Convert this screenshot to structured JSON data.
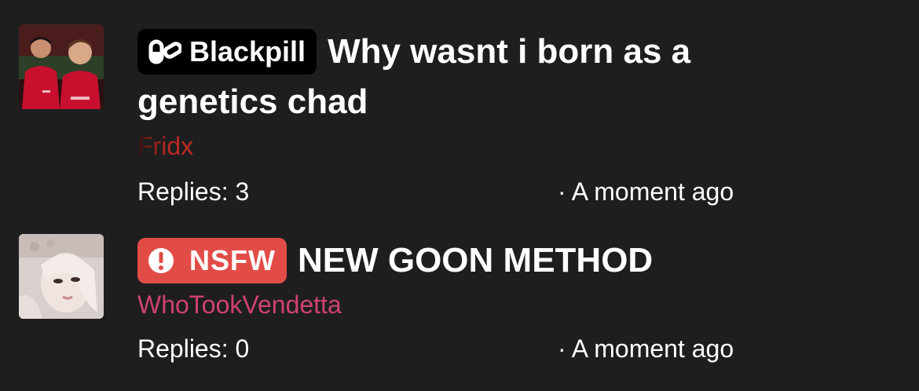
{
  "threads": [
    {
      "tag": {
        "label": "Blackpill",
        "icon": "pill-icon",
        "color": "#000000"
      },
      "title": "Why wasnt i born as a genetics chad",
      "author": "Fridx",
      "author_color": "#c62d24",
      "replies": "Replies: 3",
      "timestamp": "· A moment ago"
    },
    {
      "tag": {
        "label": "NSFW",
        "icon": "alert-icon",
        "color": "#e24c47"
      },
      "title": "NEW GOON METHOD",
      "author": "WhoTookVendetta",
      "author_color": "#d0426f",
      "replies": "Replies: 0",
      "timestamp": "· A moment ago"
    }
  ]
}
